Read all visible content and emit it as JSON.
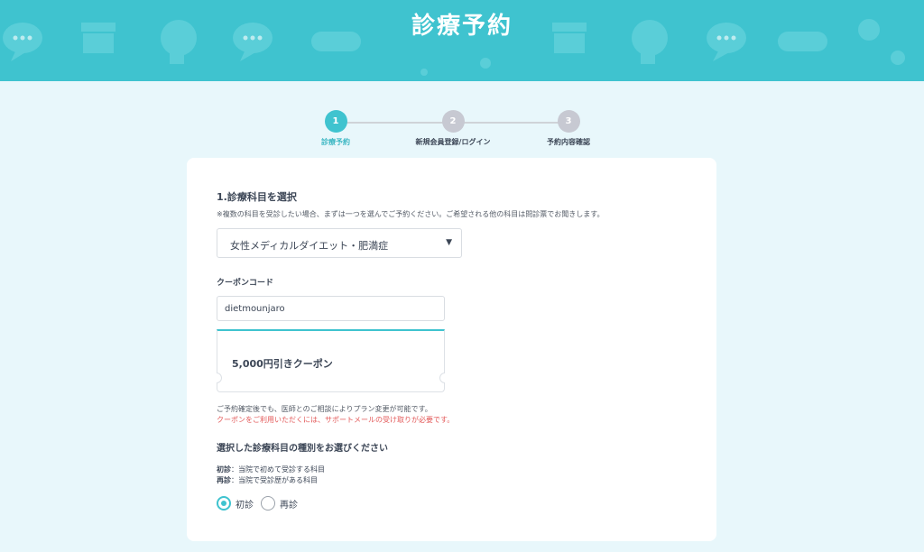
{
  "header": {
    "title": "診療予約",
    "background_color": "#3fc3cf"
  },
  "stepper": {
    "steps": [
      {
        "number": "1",
        "label": "診療予約",
        "active": true
      },
      {
        "number": "2",
        "label": "新規会員登録/ログイン",
        "active": false
      },
      {
        "number": "3",
        "label": "予約内容確認",
        "active": false
      }
    ]
  },
  "form": {
    "department": {
      "title": "1.診療科目を選択",
      "note": "※複数の科目を受診したい場合、まずは一つを選んでご予約ください。ご希望される他の科目は問診票でお聞きします。",
      "selected": "女性メディカルダイエット・肥満症",
      "arrow_icon": "triangle-down-icon"
    },
    "coupon": {
      "title": "クーポンコード",
      "value": "dietmounjaro",
      "applied_label": "5,000円引きクーポン",
      "note": "ご予約確定後でも、医師とのご相談によりプラン変更が可能です。",
      "warning": "クーポンをご利用いただくには、サポートメールの受け取りが必要です。"
    },
    "visit_type": {
      "title": "選択した診療科目の種別をお選びください",
      "desc1_term": "初診",
      "desc1_text": "：当院で初めて受診する科目",
      "desc2_term": "再診",
      "desc2_text": "：当院で受診歴がある科目",
      "options": [
        {
          "label": "初診",
          "checked": true
        },
        {
          "label": "再診",
          "checked": false
        }
      ]
    }
  },
  "colors": {
    "accent": "#3fc3cf",
    "warning": "#e35a5a",
    "page_bg": "#e8f7fb"
  }
}
